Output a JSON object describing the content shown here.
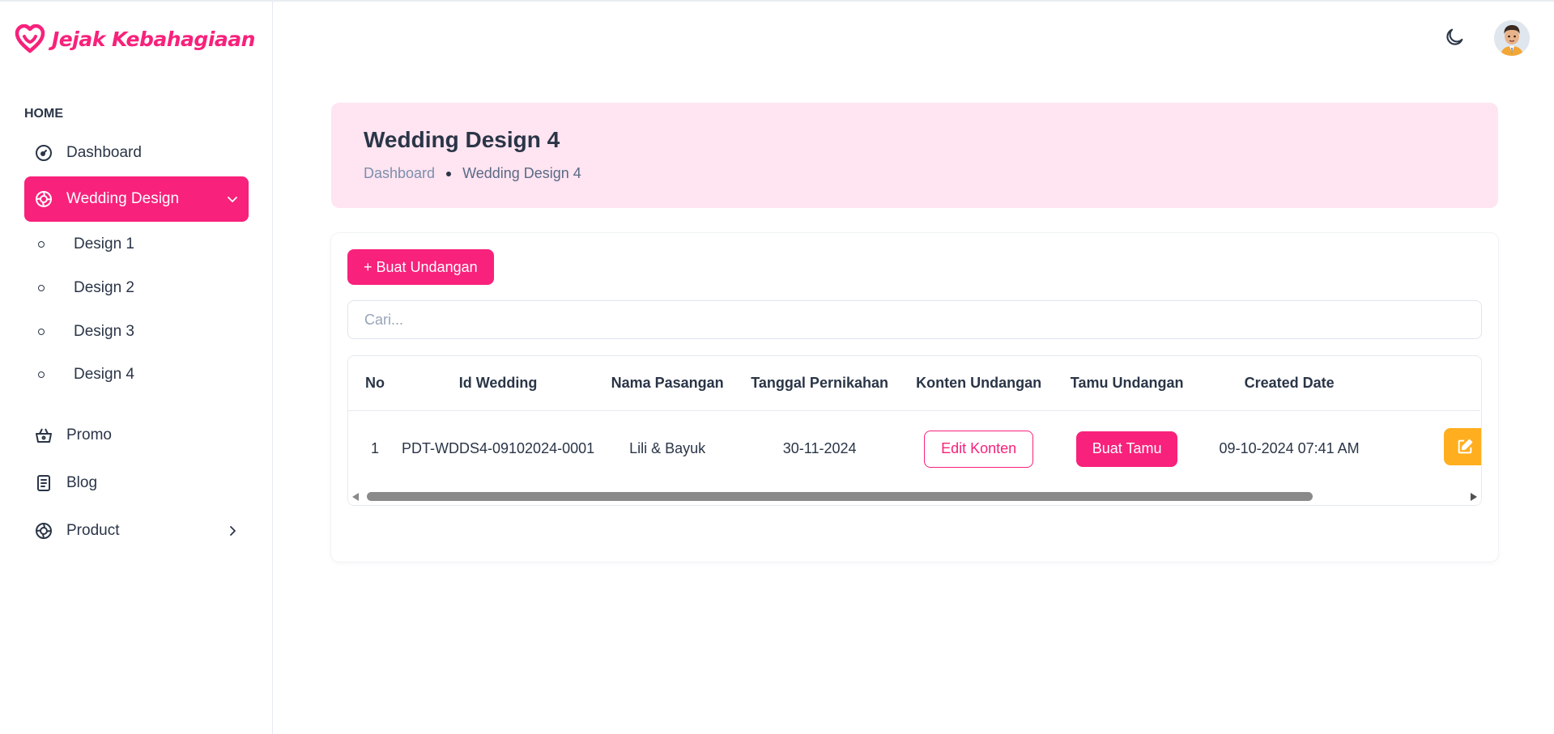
{
  "brand": {
    "name": "Jejak Kebahagiaan",
    "color": "#f8217b"
  },
  "sidebar": {
    "caption": "HOME",
    "items": [
      {
        "label": "Dashboard",
        "icon": "gauge-icon"
      },
      {
        "label": "Wedding Design",
        "icon": "aperture-icon",
        "active": true,
        "expanded": true
      },
      {
        "label": "Promo",
        "icon": "basket-icon"
      },
      {
        "label": "Blog",
        "icon": "document-icon"
      },
      {
        "label": "Product",
        "icon": "aperture-icon",
        "expanded": false
      }
    ],
    "sub_items": [
      "Design 1",
      "Design 2",
      "Design 3",
      "Design 4"
    ]
  },
  "header": {
    "theme_toggle_icon": "moon-icon",
    "avatar": "user-avatar"
  },
  "banner": {
    "title": "Wedding Design 4",
    "breadcrumb": [
      "Dashboard",
      "Wedding Design 4"
    ],
    "background": "#ffe4f1"
  },
  "toolbar": {
    "create_label": "+ Buat Undangan"
  },
  "search": {
    "placeholder": "Cari...",
    "value": ""
  },
  "table": {
    "columns": [
      "No",
      "Id Wedding",
      "Nama Pasangan",
      "Tanggal Pernikahan",
      "Konten Undangan",
      "Tamu Undangan",
      "Created Date"
    ],
    "rows": [
      {
        "no": "1",
        "id_wedding": "PDT-WDDS4-09102024-0001",
        "nama_pasangan": "Lili & Bayuk",
        "tanggal_pernikahan": "30-11-2024",
        "konten_label": "Edit Konten",
        "tamu_label": "Buat Tamu",
        "created_date": "09-10-2024 07:41 AM",
        "action_icon": "edit-icon"
      }
    ]
  },
  "colors": {
    "accent": "#f8217b",
    "warning": "#ffae1f",
    "text": "#2a3547"
  }
}
